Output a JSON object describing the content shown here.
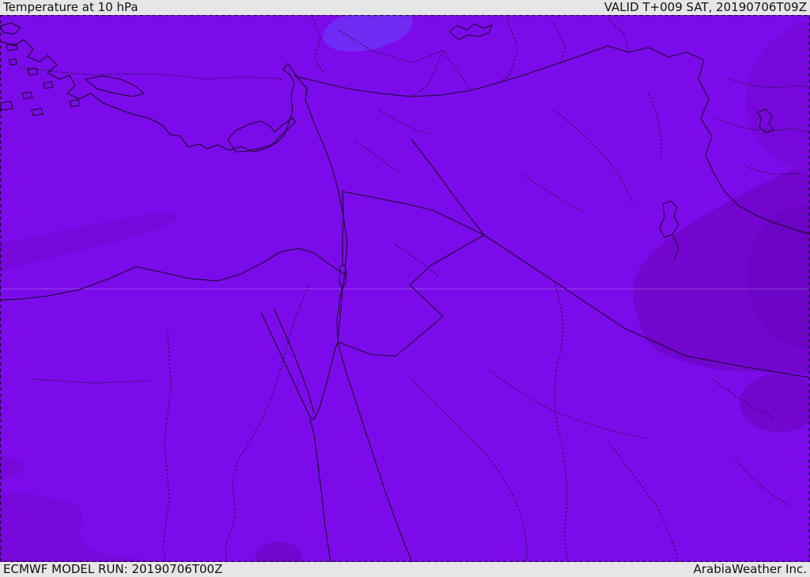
{
  "header": {
    "title": "Temperature at 10 hPa",
    "valid_label": "VALID T+009 SAT, 20190706T09Z"
  },
  "footer": {
    "model_run_label": "ECMWF MODEL RUN: 20190706T00Z",
    "brand_label": "ArabiaWeather Inc."
  },
  "map": {
    "description": "ECMWF model temperature field at 10 hPa over the Eastern Mediterranean and Middle East; warm purple field with darker pockets and one bluish cold pocket over central Turkey",
    "colors": {
      "bar_background": "#e6e6e6",
      "bar_text": "#111111",
      "base_fill": "#7c0beb",
      "shade_mid": "#7708dc",
      "shade_dark": "#7206cf",
      "shade_darkest": "#6b04c4",
      "cold_pocket": "#6f30f5",
      "coastline": "#170b26",
      "border_solid": "#1b0c2e",
      "border_dotted": "#24103a",
      "graticule": "#d9ccff",
      "frame_ticks": "#1a0b2e"
    }
  }
}
